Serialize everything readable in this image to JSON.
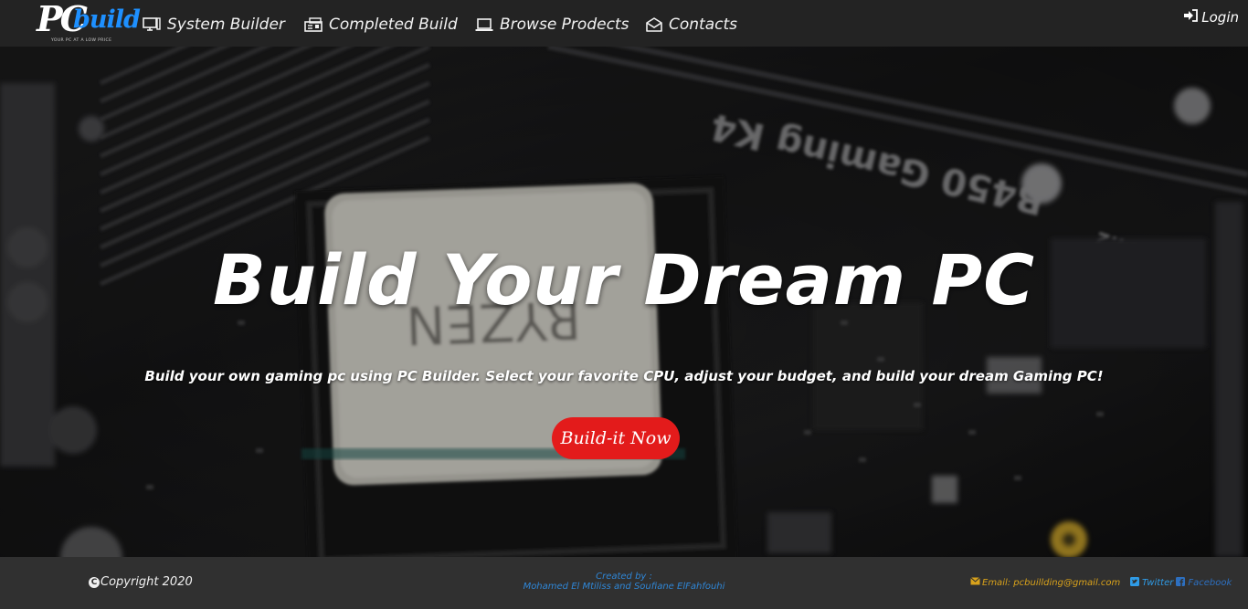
{
  "brand": {
    "logo_pc": "PC",
    "logo_build": "build",
    "tagline": "YOUR PC AT A LOW PRICE"
  },
  "nav": {
    "items": [
      {
        "label": "System Builder",
        "icon": "monitor-icon"
      },
      {
        "label": "Completed Build",
        "icon": "pc-case-icon"
      },
      {
        "label": "Browse Prodects",
        "icon": "laptop-icon"
      },
      {
        "label": "Contacts",
        "icon": "envelope-open-icon"
      }
    ],
    "login_label": "Login",
    "login_icon": "sign-in-icon"
  },
  "hero": {
    "title": "Build Your Dream PC",
    "subtitle": "Build your own gaming pc using PC Builder. Select your favorite CPU, adjust your budget, and build your dream Gaming PC!",
    "cta_label": "Build-it Now",
    "cta_color": "#e31b1b"
  },
  "footer": {
    "copyright": "Copyright 2020",
    "created_by_label": "Created by :",
    "authors": "Mohamed El Mtiliss and Soufiane ElFahfouhi",
    "email": "Email: pcbuillding@gmail.com",
    "twitter": "Twitter",
    "facebook": "Facebook"
  },
  "colors": {
    "navbar": "#232323",
    "footer": "#303030",
    "accent_blue": "#1e90ff",
    "email": "#d9a21b",
    "created_by": "#2f86d6"
  }
}
